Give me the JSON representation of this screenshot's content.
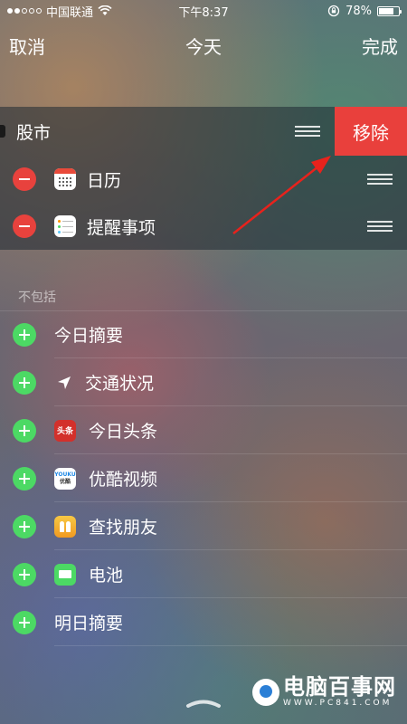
{
  "status_bar": {
    "carrier": "中国联通",
    "time": "下午8:37",
    "battery": "78%",
    "battery_level": 0.78
  },
  "nav": {
    "cancel": "取消",
    "title": "今天",
    "done": "完成"
  },
  "included": {
    "stock": {
      "label": "股市",
      "remove": "移除"
    },
    "items": [
      {
        "label": "日历",
        "icon": "calendar-icon"
      },
      {
        "label": "提醒事项",
        "icon": "reminders-icon"
      }
    ]
  },
  "excluded": {
    "header": "不包括",
    "items": [
      {
        "label": "今日摘要",
        "icon": ""
      },
      {
        "label": "交通状况",
        "icon": "location-arrow-icon"
      },
      {
        "label": "今日头条",
        "icon": "toutiao-icon",
        "icon_text": "头条"
      },
      {
        "label": "优酷视频",
        "icon": "youku-icon",
        "icon_text_1": "YOUKU",
        "icon_text_2": "优酷"
      },
      {
        "label": "查找朋友",
        "icon": "find-friends-icon"
      },
      {
        "label": "电池",
        "icon": "battery-icon"
      },
      {
        "label": "明日摘要",
        "icon": ""
      }
    ]
  },
  "watermark": {
    "main": "电脑百事网",
    "sub": "WWW.PC841.COM"
  },
  "colors": {
    "remove_red": "#e9403c",
    "minus_red": "#e8423d",
    "plus_green": "#4cd964",
    "arrow_red": "#e8221c"
  }
}
